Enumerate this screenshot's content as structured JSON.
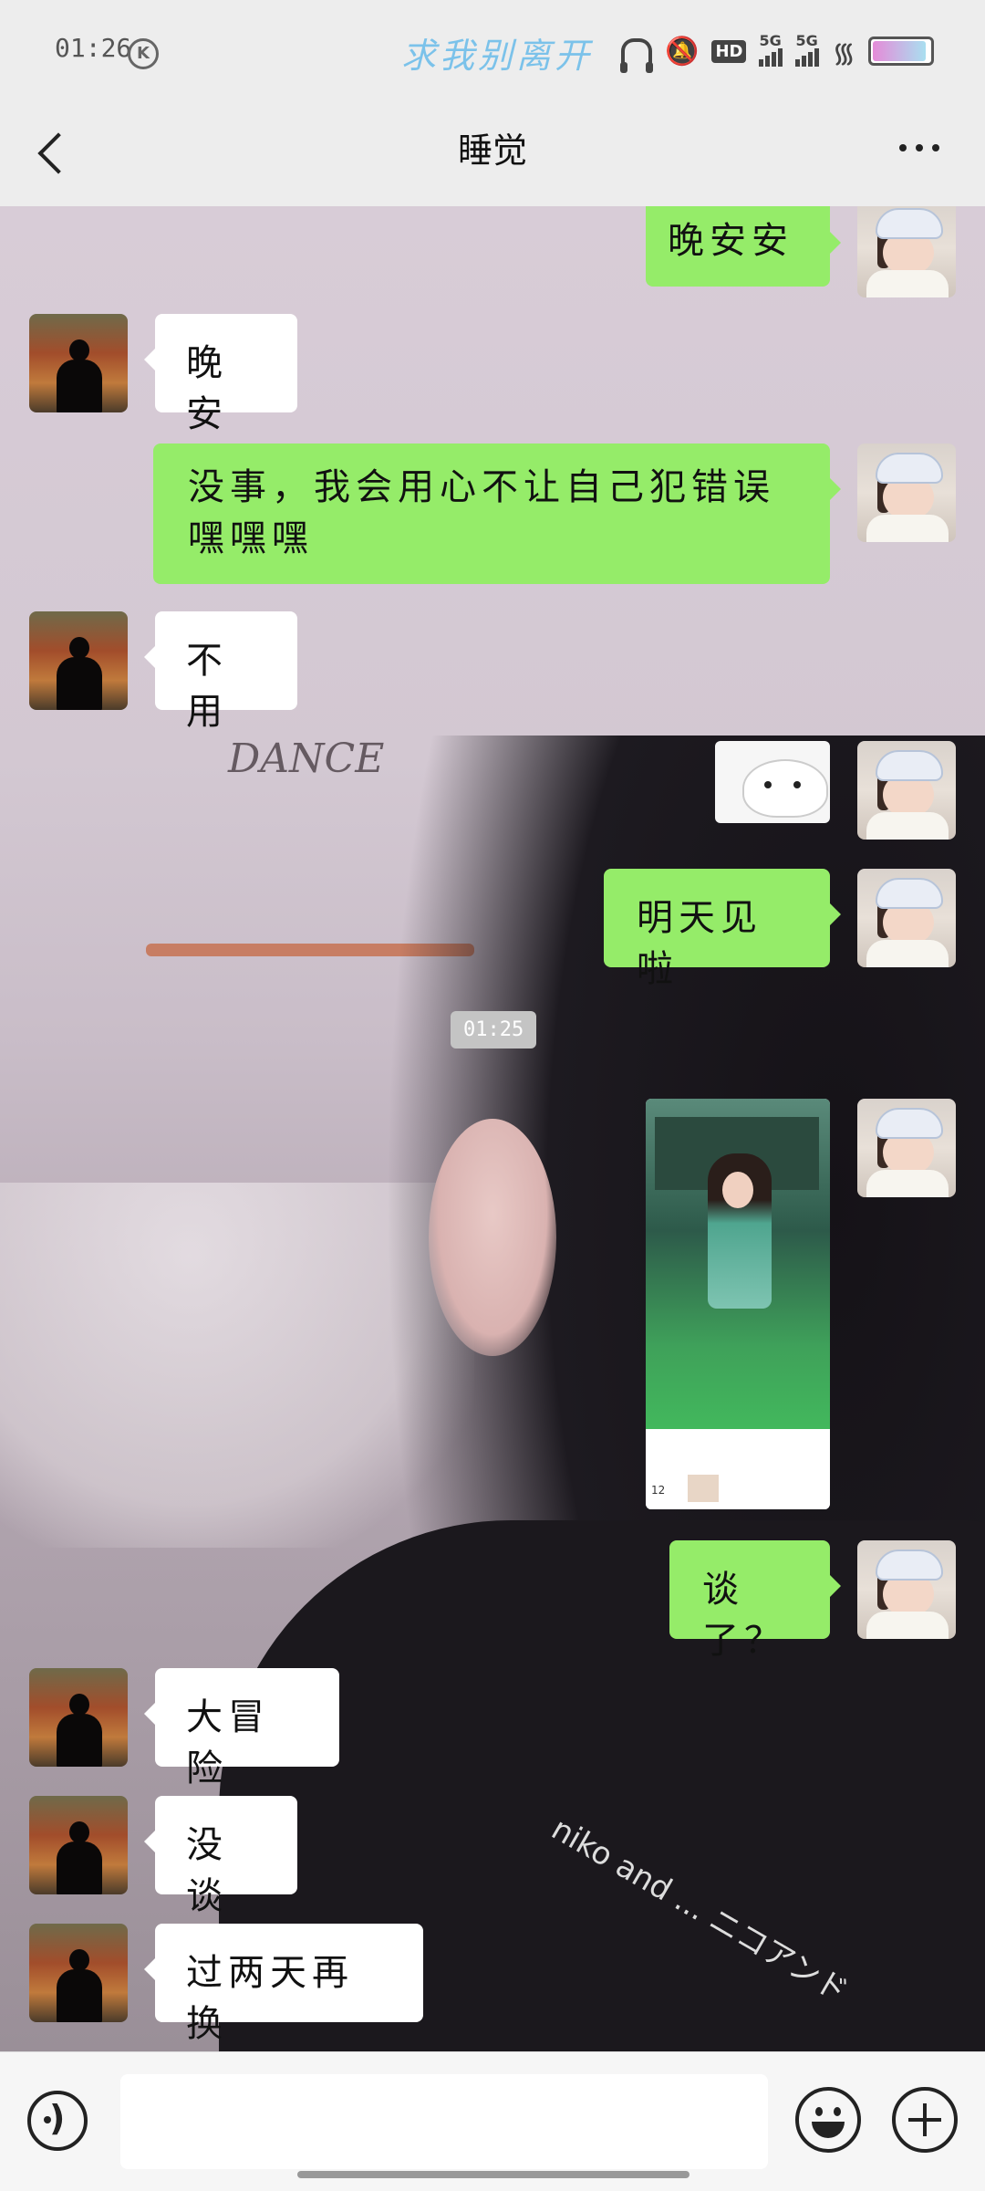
{
  "status": {
    "time": "01:26",
    "banner": "求我别离开",
    "net1": "5G",
    "net2": "5G"
  },
  "nav": {
    "title": "睡觉"
  },
  "messages": [
    {
      "side": "me",
      "text": "晚安安"
    },
    {
      "side": "friend",
      "text": "晚安"
    },
    {
      "side": "me",
      "text": "没事，我会用心不让自己犯错误嘿嘿嘿"
    },
    {
      "side": "friend",
      "text": "不用"
    },
    {
      "side": "me",
      "type": "sticker"
    },
    {
      "side": "me",
      "text": "明天见啦"
    },
    {
      "side": "me",
      "type": "photo"
    },
    {
      "side": "me",
      "text": "谈了？"
    },
    {
      "side": "friend",
      "text": "大冒险"
    },
    {
      "side": "friend",
      "text": "没谈"
    },
    {
      "side": "friend",
      "text": "过两天再换"
    }
  ],
  "timestamp": "01:25",
  "background": {
    "wall_text": "DANCE",
    "shirt_text": "niko and ... ニコアンド"
  },
  "photo": {
    "footer_count": "12"
  },
  "colors": {
    "my_bubble": "#95ec69",
    "friend_bubble": "#ffffff",
    "chrome": "#ededed"
  },
  "icons": {
    "back": "chevron-left-icon",
    "more": "more-icon",
    "voice": "voice-icon",
    "emoji": "emoji-icon",
    "plus": "plus-icon"
  }
}
